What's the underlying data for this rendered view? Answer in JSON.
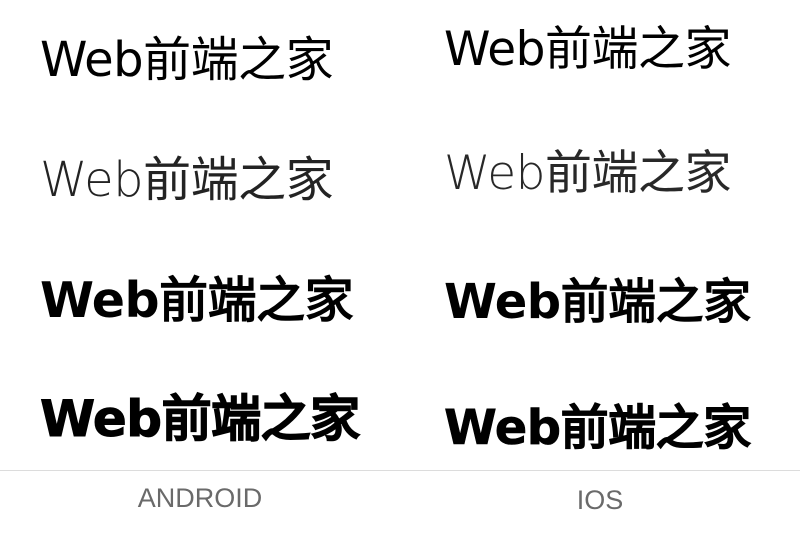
{
  "samples": {
    "android": [
      {
        "text": "Web前端之家",
        "weight": "regular"
      },
      {
        "text": "Web前端之家",
        "weight": "light"
      },
      {
        "text": "Web前端之家",
        "weight": "bold"
      },
      {
        "text": "Web前端之家",
        "weight": "black"
      }
    ],
    "ios": [
      {
        "text": "Web前端之家",
        "weight": "regular"
      },
      {
        "text": "Web前端之家",
        "weight": "light"
      },
      {
        "text": "Web前端之家",
        "weight": "bold"
      },
      {
        "text": "Web前端之家",
        "weight": "heavy"
      }
    ]
  },
  "footer": {
    "android_label": "ANDROID",
    "ios_label": "IOS"
  },
  "colors": {
    "text": "#000000",
    "label": "#6a6a6a",
    "divider": "#dcdcdc",
    "background": "#ffffff"
  }
}
